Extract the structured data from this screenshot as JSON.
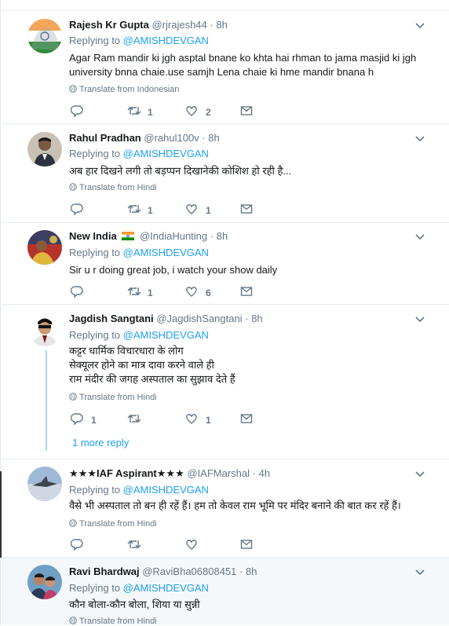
{
  "tweets": [
    {
      "name": "Rajesh Kr Gupta",
      "handle": "@rjrajesh44",
      "time": "8h",
      "replying_prefix": "Replying to ",
      "replying_to": "@AMISHDEVGAN",
      "text_lines": [
        "Agar Ram mandir ki jgh asptal bnane ko khta hai rhman to jama masjid ki jgh",
        "university bnna chaie.use samjh Lena chaie ki hme mandir bnana h"
      ],
      "translate": "Translate from Indonesian",
      "replies": "",
      "retweets": "1",
      "likes": "2"
    },
    {
      "name": "Rahul Pradhan",
      "handle": "@rahul100v",
      "time": "8h",
      "replying_prefix": "Replying to ",
      "replying_to": "@AMISHDEVGAN",
      "text_lines": [
        "अब हार दिखने लगी तो बड़प्पन दिखानेकी कोशिश हो रही है..."
      ],
      "translate": "Translate from Hindi",
      "replies": "",
      "retweets": "1",
      "likes": "1"
    },
    {
      "name": "New India",
      "flag": "🇮🇳",
      "handle": "@IndiaHunting",
      "time": "8h",
      "replying_prefix": "Replying to ",
      "replying_to": "@AMISHDEVGAN",
      "text_lines": [
        "Sir u r doing great job, i watch your show daily"
      ],
      "translate": "",
      "replies": "",
      "retweets": "1",
      "likes": "6"
    },
    {
      "name": "Jagdish Sangtani",
      "handle": "@JagdishSangtani",
      "time": "8h",
      "replying_prefix": "Replying to ",
      "replying_to": "@AMISHDEVGAN",
      "text_lines": [
        "कट्टर धार्मिक विचारधारा के लोग",
        "सेक्यूलर होने का मात्र दावा करने वाले ही",
        "राम मंदीर की जगह अस्पताल का सुझाव देते हैं"
      ],
      "translate": "Translate from Hindi",
      "replies": "1",
      "retweets": "",
      "likes": "1",
      "more_replies": "1 more reply"
    },
    {
      "name": "★★★IAF Aspirant★★★",
      "handle": "@IAFMarshal",
      "time": "4h",
      "replying_prefix": "Replying to ",
      "replying_to": "@AMISHDEVGAN",
      "text_lines": [
        "वैसे भी अस्पताल तो बन ही रहें हैं। हम तो केवल राम भूमि पर मंदिर बनाने की बात कर रहें हैं।"
      ],
      "translate": "Translate from Hindi",
      "replies": "",
      "retweets": "",
      "likes": ""
    },
    {
      "name": "Ravi Bhardwaj",
      "handle": "@RaviBha06808451",
      "time": "8h",
      "replying_prefix": "Replying to ",
      "replying_to": "@AMISHDEVGAN",
      "text_lines": [
        "कौन बोला-कौन बोला, शिया या सुन्नी"
      ],
      "translate": "Translate from Hindi"
    }
  ],
  "colors": {
    "link": "#1da1f2",
    "muted": "#657786",
    "border": "#e6ecf0",
    "highlight_bg": "#f5f8fa",
    "thread_line": "#a9d6f5"
  },
  "icons": [
    "reply-icon",
    "retweet-icon",
    "like-icon",
    "message-icon",
    "globe-icon",
    "chevron-down-icon"
  ]
}
